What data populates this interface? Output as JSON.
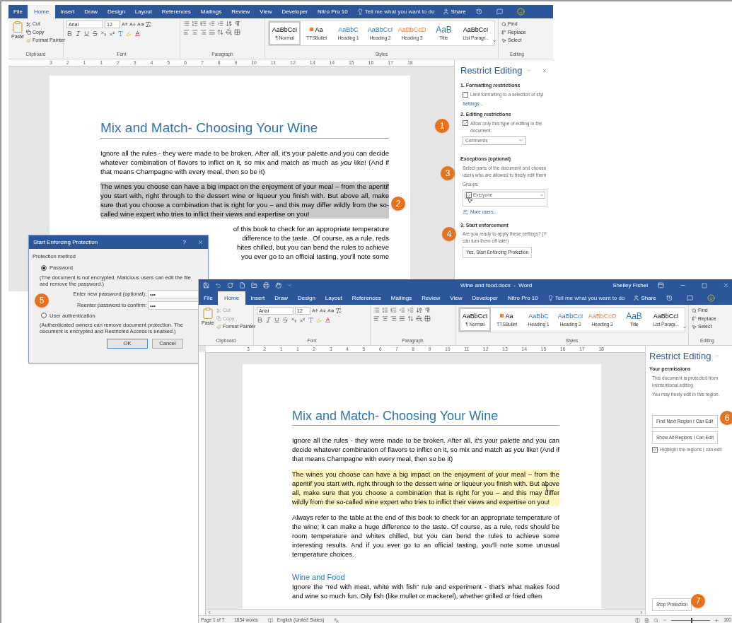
{
  "window_1": {
    "tabs": [
      {
        "label": "File",
        "selected": false
      },
      {
        "label": "Home",
        "selected": true
      },
      {
        "label": "Insert",
        "selected": false
      },
      {
        "label": "Draw",
        "selected": false
      },
      {
        "label": "Design",
        "selected": false
      },
      {
        "label": "Layout",
        "selected": false
      },
      {
        "label": "References",
        "selected": false
      },
      {
        "label": "Mailings",
        "selected": false
      },
      {
        "label": "Review",
        "selected": false
      },
      {
        "label": "View",
        "selected": false
      },
      {
        "label": "Developer",
        "selected": false
      },
      {
        "label": "Nitro Pro 10",
        "selected": false
      }
    ],
    "tell_me": "Tell me what you want to do",
    "share": "Share",
    "ribbon": {
      "clipboard": {
        "paste": "Paste",
        "cut": {
          "label": "Cut",
          "disabled": false
        },
        "copy": {
          "label": "Copy",
          "disabled": false
        },
        "format_painter": "Format Painter",
        "label": "Clipboard"
      },
      "font": {
        "name": "Arial",
        "size": "12",
        "label": "Font"
      },
      "paragraph": {
        "label": "Paragraph"
      },
      "styles": {
        "items": [
          {
            "preview": "AaBbCcI",
            "name": "¶ Normal",
            "kind": "plain",
            "selected": true
          },
          {
            "preview": "Aa",
            "name": "TTSBullet",
            "kind": "plain",
            "selected": false
          },
          {
            "preview": "AaBbC",
            "name": "Heading 1",
            "kind": "heading",
            "selected": false
          },
          {
            "preview": "AaBbCcI",
            "name": "Heading 2",
            "kind": "heading",
            "selected": false
          },
          {
            "preview": "AaBbCcD",
            "name": "Heading 3",
            "kind": "accent",
            "selected": false
          },
          {
            "preview": "AaB",
            "name": "Title",
            "kind": "title",
            "selected": false
          },
          {
            "preview": "AaBbCcI",
            "name": "List Paragr...",
            "kind": "plain",
            "selected": false
          }
        ],
        "label": "Styles"
      },
      "editing": {
        "find": "Find",
        "replace": "Replace",
        "select": "Select",
        "label": "Editing"
      }
    },
    "ruler": [
      "3",
      "2",
      "1",
      "1",
      "2",
      "3",
      "4",
      "5",
      "6",
      "7",
      "8",
      "9",
      "10",
      "11",
      "12",
      "13",
      "14",
      "15",
      "16",
      "17",
      "18"
    ],
    "document": {
      "title": "Mix and Match- Choosing Your Wine",
      "paragraphs": [
        {
          "text": "Ignore all the rules - they were made to be broken.  After all, it's your palette and you can decide whatever combination of flavors to inflict on it, so mix and match as much as *you* like! (And if that means Champagne with every meal, then so be it)",
          "highlighted": false
        },
        {
          "text": "The wines you choose can have a big impact on the enjoyment of your meal – from the aperitif you start with, right through to the dessert wine or liqueur you finish with. But above all, make sure that you choose a combination that is right for you – and this may differ wildly from the so-called wine expert who tries to inflict their views and expertise on you!",
          "highlighted": true
        }
      ],
      "partial_lines": [
        "of this book to check for an appropriate temperature",
        "difference to the taste.  Of course, as a rule, reds",
        "hites chilled, but you can bend the rules to achieve",
        "you ever go to an official tasting, you'll note some"
      ]
    },
    "panel": {
      "title": "Restrict Editing",
      "formatting_heading": "1. Formatting restrictions",
      "formatting_check": {
        "label": "Limit formatting to a selection of styl",
        "checked": false
      },
      "settings": "Settings...",
      "editing_heading": "2. Editing restrictions",
      "editing_check": {
        "label": "Allow only this type of editing in the document:",
        "checked": true
      },
      "editing_type": "Comments",
      "exceptions_heading": "Exceptions (optional)",
      "exceptions_text": "Select parts of the document and choose users who are allowed to freely edit them",
      "groups_label": "Groups:",
      "group": {
        "label": "Everyone",
        "checked": true
      },
      "more_users": "More users...",
      "enforcement_heading": "3. Start enforcement",
      "enforcement_lines": [
        "Are you ready to apply these settings? (Y",
        "can turn them off later)"
      ],
      "enforce_button": "Yes, Start Enforcing Protection"
    }
  },
  "dialog": {
    "title": "Start Enforcing Protection",
    "help": "?",
    "section": "Protection method",
    "options": [
      {
        "label": "Password",
        "selected": true,
        "note": "(The document is not encrypted. Malicious users can edit the file and remove the password.)"
      },
      {
        "label": "User authentication",
        "selected": false,
        "note": "(Authenticated owners can remove document protection. The document is encrypted and Restricted Access is enabled.)"
      }
    ],
    "new_password": {
      "label": "Enter new password (optional):",
      "value": "•••"
    },
    "confirm_password": {
      "label": "Reenter password to confirm:",
      "value": "•••"
    },
    "buttons": [
      "OK",
      "Cancel"
    ]
  },
  "window_2": {
    "title": "Wine and food.docx  -  Word",
    "user": "Shelley Fishel",
    "tabs": [
      {
        "label": "File",
        "selected": false
      },
      {
        "label": "Home",
        "selected": true
      },
      {
        "label": "Insert",
        "selected": false
      },
      {
        "label": "Draw",
        "selected": false
      },
      {
        "label": "Design",
        "selected": false
      },
      {
        "label": "Layout",
        "selected": false
      },
      {
        "label": "References",
        "selected": false
      },
      {
        "label": "Mailings",
        "selected": false
      },
      {
        "label": "Review",
        "selected": false
      },
      {
        "label": "View",
        "selected": false
      },
      {
        "label": "Developer",
        "selected": false
      },
      {
        "label": "Nitro Pro 10",
        "selected": false
      }
    ],
    "tell_me": "Tell me what you want to do",
    "share": "Share",
    "ribbon": {
      "clipboard": {
        "paste": "Paste",
        "cut": {
          "label": "Cut",
          "disabled": true
        },
        "copy": {
          "label": "Copy",
          "disabled": true
        },
        "format_painter": "Format Painter",
        "label": "Clipboard"
      },
      "font": {
        "name": "Arial",
        "size": "12",
        "label": "Font"
      },
      "paragraph": {
        "label": "Paragraph"
      },
      "styles": {
        "items": [
          {
            "preview": "AaBbCcI",
            "name": "¶ Normal",
            "kind": "plain",
            "selected": true
          },
          {
            "preview": "Aa",
            "name": "TTSBullet",
            "kind": "plain",
            "selected": false
          },
          {
            "preview": "AaBbC",
            "name": "Heading 1",
            "kind": "heading",
            "selected": false
          },
          {
            "preview": "AaBbCcI",
            "name": "Heading 2",
            "kind": "heading",
            "selected": false
          },
          {
            "preview": "AaBbCcD",
            "name": "Heading 3",
            "kind": "accent",
            "selected": false
          },
          {
            "preview": "AaB",
            "name": "Title",
            "kind": "title",
            "selected": false
          },
          {
            "preview": "AaBbCcI",
            "name": "List Paragr...",
            "kind": "plain",
            "selected": false
          }
        ],
        "label": "Styles"
      },
      "editing": {
        "find": "Find",
        "replace": "Replace",
        "select": "Select",
        "label": "Editing"
      }
    },
    "ruler": [
      "3",
      "2",
      "1",
      "1",
      "2",
      "3",
      "4",
      "5",
      "6",
      "7",
      "8",
      "9",
      "10",
      "11",
      "12",
      "13",
      "14",
      "15",
      "16",
      "17",
      "18"
    ],
    "document": {
      "title": "Mix and Match- Choosing Your Wine",
      "paragraphs": [
        {
          "text": "Ignore all the rules - they were made to be broken.  After all, it's your palette and you can decide whatever combination of flavors to inflict on it, so mix and match as *you* like! (And if that means Champagne with every meal, then so be it)",
          "highlighted": false
        },
        {
          "text": "The wines you choose can have a big impact on the enjoyment of your meal – from the aperitif you start with, right through to the dessert wine or liqueur you finish with. But above all, make sure that you choose a combination that is right for you – and this may differ wildly from the so-called wine expert who tries to inflict their views and expertise on you!",
          "highlighted": true
        },
        {
          "text": "Always refer to the table at the end of this book to check for an appropriate temperature of the wine; it can make a huge difference to the taste.  Of course, as a rule, reds should be room temperature and whites chilled, but you can bend the rules to achieve some interesting results.  And if you ever go to an official tasting, you'll note some unusual temperature choices.",
          "highlighted": false
        }
      ],
      "subheading": "Wine and Food",
      "last_paragraph": "Ignore the “red with meat, white with fish” rule and experiment - that's what makes food and wine so much fun.  Oily fish (like mullet or mackerel), whether grilled or fried often"
    },
    "panel": {
      "title": "Restrict Editing",
      "permissions_heading": "Your permissions",
      "lines": [
        "This document is protected from unintentional editing.",
        "You may freely edit in this region."
      ],
      "buttons": [
        "Find Next Region I Can Edit",
        "Show All Regions I Can Edit"
      ],
      "highlight_check": {
        "label": "Highlight the regions I can edit",
        "checked": true
      },
      "stop_button": "Stop Protection"
    },
    "status": {
      "page": "Page 1 of 7",
      "words": "1834 words",
      "language": "English (United States)",
      "zoom": {
        "level": 0.5,
        "reading": "100"
      }
    }
  },
  "callouts": [
    "1",
    "2",
    "3",
    "4",
    "5",
    "6",
    "7"
  ]
}
